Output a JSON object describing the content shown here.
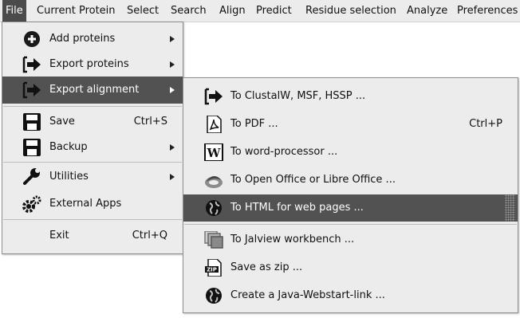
{
  "menubar": {
    "items": [
      {
        "label": "File"
      },
      {
        "label": "Current Protein"
      },
      {
        "label": "Select"
      },
      {
        "label": "Search"
      },
      {
        "label": "Align"
      },
      {
        "label": "Predict"
      },
      {
        "label": "Residue selection"
      },
      {
        "label": "Analyze"
      },
      {
        "label": "Preferences"
      }
    ]
  },
  "file_menu": {
    "items": [
      {
        "label": "Add proteins",
        "icon": "plus-circle-icon",
        "has_submenu": true
      },
      {
        "label": "Export proteins",
        "icon": "export-arrow-icon",
        "has_submenu": true
      },
      {
        "label": "Export alignment",
        "icon": "export-arrow-icon",
        "has_submenu": true,
        "highlighted": true
      },
      {
        "label": "Save",
        "icon": "floppy-disk-icon",
        "shortcut": "Ctrl+S"
      },
      {
        "label": "Backup",
        "icon": "floppy-disk-icon",
        "has_submenu": true
      },
      {
        "label": "Utilities",
        "icon": "wrench-icon",
        "has_submenu": true
      },
      {
        "label": "External Apps",
        "icon": "gears-icon"
      },
      {
        "label": "Exit",
        "shortcut": "Ctrl+Q"
      }
    ]
  },
  "export_submenu": {
    "items": [
      {
        "label": "To ClustalW, MSF, HSSP ...",
        "icon": "export-arrow-icon"
      },
      {
        "label": "To PDF ...",
        "icon": "pdf-icon",
        "shortcut": "Ctrl+P"
      },
      {
        "label": "To word-processor ...",
        "icon": "word-document-icon"
      },
      {
        "label": "To Open Office or Libre Office ...",
        "icon": "openoffice-icon"
      },
      {
        "label": "To HTML for web pages ...",
        "icon": "globe-icon",
        "highlighted": true
      },
      {
        "label": "To Jalview workbench ...",
        "icon": "jalview-icon"
      },
      {
        "label": "Save as zip ...",
        "icon": "zip-file-icon"
      },
      {
        "label": "Create a Java-Webstart-link ...",
        "icon": "globe-icon"
      }
    ]
  },
  "colors": {
    "menu_bg": "#ececec",
    "highlight": "#525252",
    "menubar_active": "#4b4b4b"
  }
}
